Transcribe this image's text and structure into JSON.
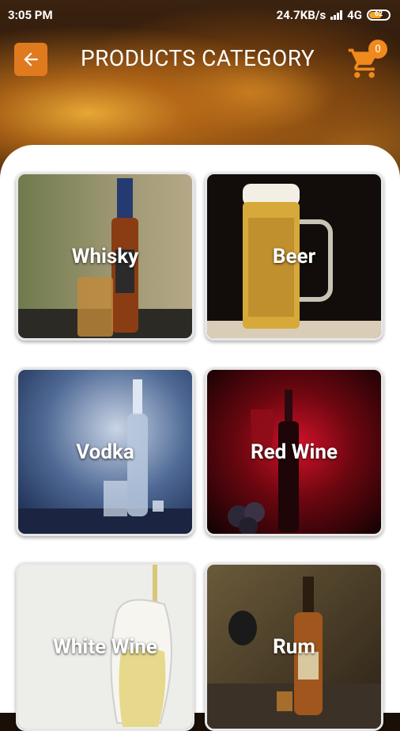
{
  "status_bar": {
    "time": "3:05 PM",
    "network_speed": "24.7KB/s",
    "network_type": "4G",
    "battery": "62"
  },
  "header": {
    "title": "PRODUCTS CATEGORY",
    "cart_count": "0",
    "back_icon": "arrow-left-icon",
    "cart_icon": "shopping-cart-icon"
  },
  "colors": {
    "accent": "#e07a1f",
    "panel": "#ffffff"
  },
  "categories": [
    {
      "label": "Whisky"
    },
    {
      "label": "Beer"
    },
    {
      "label": "Vodka"
    },
    {
      "label": "Red Wine"
    },
    {
      "label": "White Wine"
    },
    {
      "label": "Rum"
    }
  ]
}
